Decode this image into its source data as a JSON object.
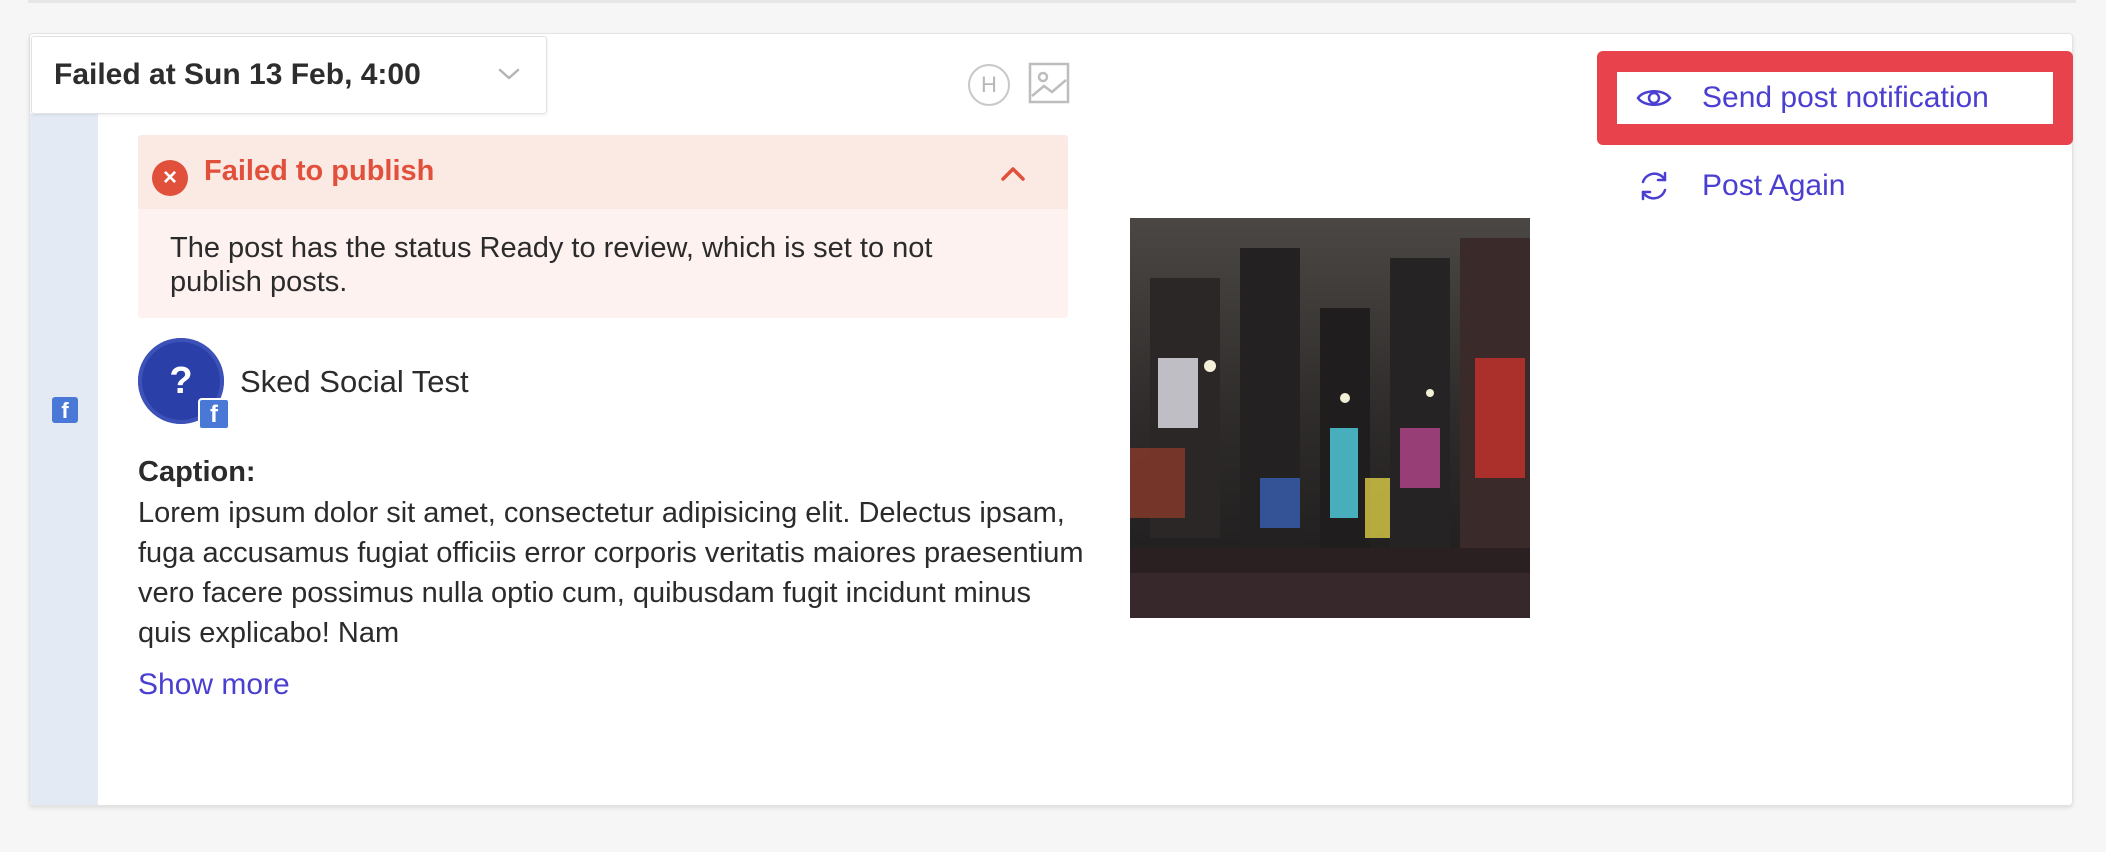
{
  "post": {
    "status_label": "Failed at Sun 13 Feb, 4:00",
    "tools": {
      "heading_icon_text": "H"
    },
    "error": {
      "title": "Failed to publish",
      "message": "The post has the status Ready to review, which is set to not publish posts."
    },
    "account": {
      "avatar_text": "?",
      "name": "Sked Social Test",
      "network_badge": "f"
    },
    "caption": {
      "label": "Caption:",
      "text": "Lorem ipsum dolor sit amet, consectetur adipisicing elit. Delectus ipsam, fuga accusamus fugiat officiis error corporis veritatis maiores praesentium vero facere possimus nulla optio cum, quibusdam fugit incidunt minus quis explicabo! Nam",
      "show_more": "Show more"
    },
    "strip_badge": "f"
  },
  "actions": [
    {
      "label": "Send post notification",
      "icon": "eye-icon",
      "highlighted": true
    },
    {
      "label": "Post Again",
      "icon": "refresh-icon",
      "highlighted": false
    }
  ],
  "colors": {
    "accent": "#4a3fd0",
    "error": "#e0503b",
    "highlight": "#e8424d",
    "facebook": "#4a78d6"
  }
}
